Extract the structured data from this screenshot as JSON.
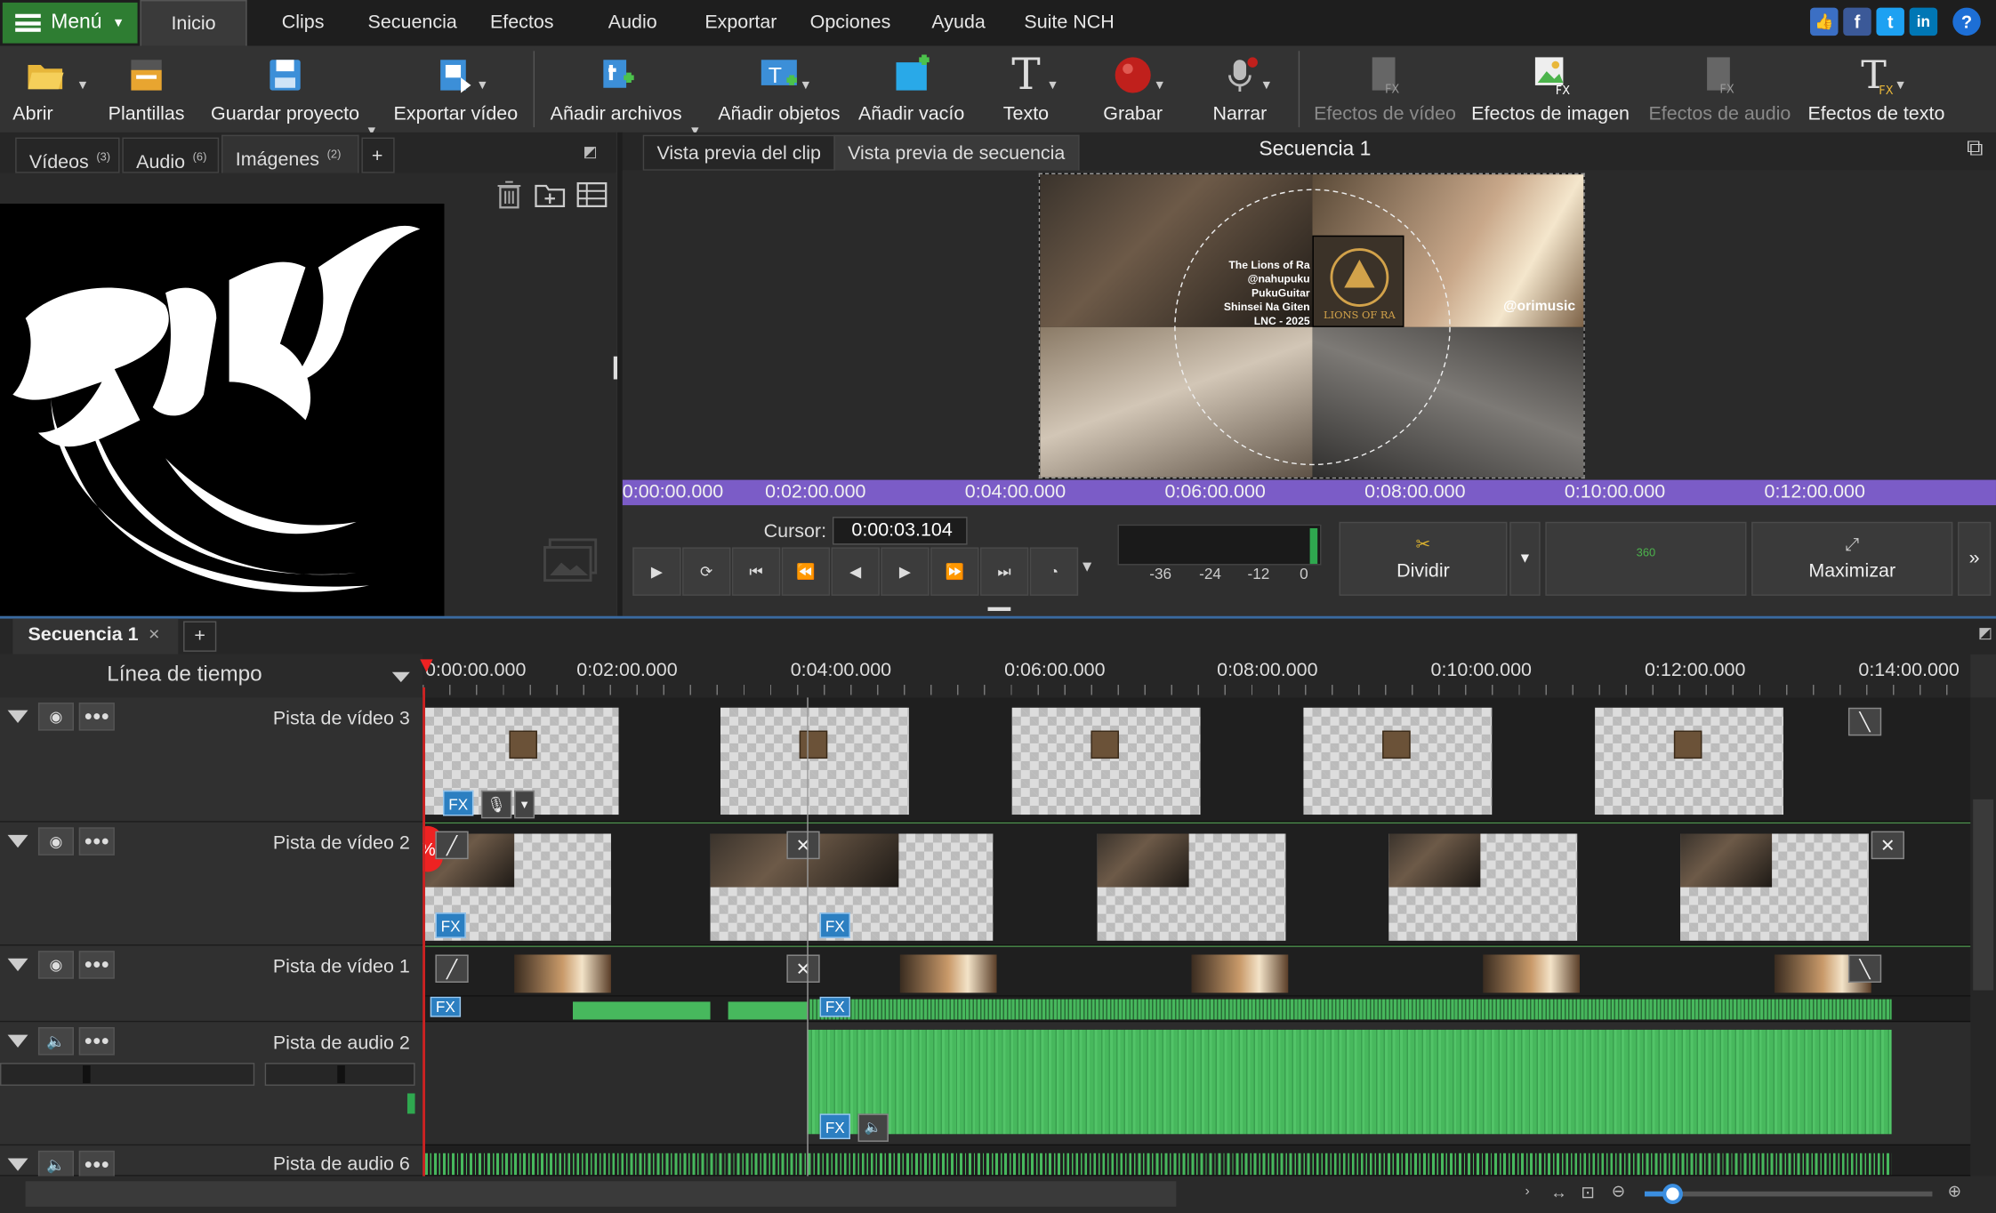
{
  "menubar": {
    "menu_label": "Menú",
    "tabs": [
      "Inicio",
      "Clips",
      "Secuencia",
      "Efectos",
      "Audio",
      "Exportar",
      "Opciones",
      "Ayuda",
      "Suite NCH"
    ],
    "social": [
      "like",
      "f",
      "t",
      "in",
      "?"
    ]
  },
  "toolbar": {
    "abrir": "Abrir",
    "plantillas": "Plantillas",
    "guardar": "Guardar proyecto",
    "exportar": "Exportar vídeo",
    "anadir_archivos": "Añadir archivos",
    "anadir_objetos": "Añadir objetos",
    "anadir_vacio": "Añadir vacío",
    "texto": "Texto",
    "grabar": "Grabar",
    "narrar": "Narrar",
    "efectos_video": "Efectos de vídeo",
    "efectos_imagen": "Efectos de imagen",
    "efectos_audio": "Efectos de audio",
    "efectos_texto": "Efectos de texto",
    "text_glyph": "T"
  },
  "media_bin": {
    "tabs": [
      {
        "label": "Vídeos",
        "count": "(3)"
      },
      {
        "label": "Audio",
        "count": "(6)"
      },
      {
        "label": "Imágenes",
        "count": "(2)"
      }
    ],
    "add": "+"
  },
  "preview": {
    "tab_clip": "Vista previa del clip",
    "tab_seq": "Vista previa de secuencia",
    "title": "Secuencia 1",
    "overlay_lines": [
      "The Lions of Ra",
      "@nahupuku",
      "PukuGuitar",
      "Shinsei Na Giten",
      "LNC - 2025"
    ],
    "handle": "@orimusic",
    "emblem": "LIONS OF RA",
    "ruler": [
      "0:00:00.000",
      "0:02:00.000",
      "0:04:00.000",
      "0:06:00.000",
      "0:08:00.000",
      "0:10:00.000",
      "0:12:00.000"
    ]
  },
  "transport": {
    "cursor_label": "Cursor:",
    "cursor_value": "0:00:03.104",
    "meter": [
      "-36",
      "-24",
      "-12",
      "0"
    ],
    "dividir": "Dividir",
    "maximizar": "Maximizar",
    "more": "»",
    "cam360": "360"
  },
  "sequence_tabs": {
    "active": "Secuencia 1",
    "close": "×",
    "add": "+"
  },
  "timeline": {
    "header": "Línea de tiempo",
    "ruler": [
      "0:00:00.000",
      "0:02:00.000",
      "0:04:00.000",
      "0:06:00.000",
      "0:08:00.000",
      "0:10:00.000",
      "0:12:00.000",
      "0:14:00.000"
    ],
    "tracks": [
      "Pista de vídeo 3",
      "Pista de vídeo 2",
      "Pista de vídeo 1",
      "Pista de audio 2",
      "Pista de audio 6"
    ],
    "fx": "FX",
    "percent": "%"
  }
}
